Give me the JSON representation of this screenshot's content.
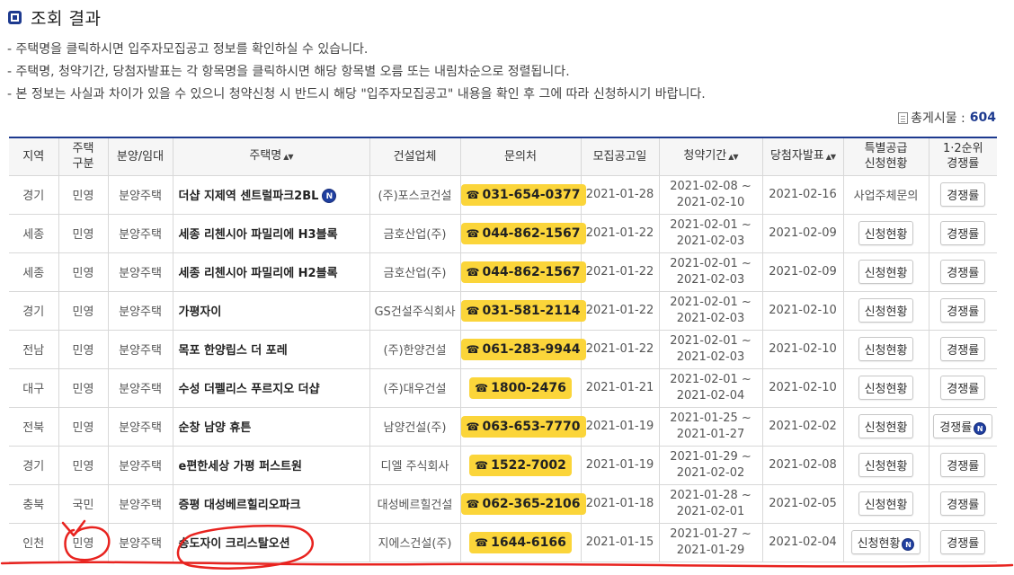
{
  "section_title": "조회 결과",
  "notes": [
    "- 주택명을 클릭하시면 입주자모집공고 정보를 확인하실 수 있습니다.",
    "- 주택명, 청약기간, 당첨자발표는 각 항목명을 클릭하시면 해당 항목별 오름 또는 내림차순으로 정렬됩니다.",
    "- 본 정보는 사실과 차이가 있을 수 있으니 청약신청 시 반드시 해당 \"입주자모집공고\" 내용을 확인 후 그에 따라 신청하시기 바랍니다."
  ],
  "total": {
    "label": "총게시물 :",
    "count": "604"
  },
  "headers": {
    "region": "지역",
    "house_type_1": "주택",
    "house_type_2": "구분",
    "sale_rent": "분양/임대",
    "name": "주택명",
    "builder": "건설업체",
    "contact": "문의처",
    "announce": "모집공고일",
    "period": "청약기간",
    "winner": "당첨자발표",
    "special_1": "특별공급",
    "special_2": "신청현황",
    "rank_1": "1·2순위",
    "rank_2": "경쟁률"
  },
  "sort_icon": "▲▼",
  "new_badge": "N",
  "phone_icon": "☎",
  "rows": [
    {
      "region": "경기",
      "type": "민영",
      "sale": "분양주택",
      "name": "더샵 지제역 센트럴파크2BL",
      "name_new": true,
      "builder": "(주)포스코건설",
      "phone": "031-654-0377",
      "announce": "2021-01-28",
      "period_start": "2021-02-08 ~",
      "period_end": "2021-02-10",
      "winner": "2021-02-16",
      "special": "사업주체문의",
      "special_is_button": false,
      "special_new": false,
      "rank": "경쟁률",
      "rank_new": false
    },
    {
      "region": "세종",
      "type": "민영",
      "sale": "분양주택",
      "name": "세종 리첸시아 파밀리에 H3블록",
      "name_new": false,
      "builder": "금호산업(주)",
      "phone": "044-862-1567",
      "announce": "2021-01-22",
      "period_start": "2021-02-01 ~",
      "period_end": "2021-02-03",
      "winner": "2021-02-09",
      "special": "신청현황",
      "special_is_button": true,
      "special_new": false,
      "rank": "경쟁률",
      "rank_new": false
    },
    {
      "region": "세종",
      "type": "민영",
      "sale": "분양주택",
      "name": "세종 리첸시아 파밀리에 H2블록",
      "name_new": false,
      "builder": "금호산업(주)",
      "phone": "044-862-1567",
      "announce": "2021-01-22",
      "period_start": "2021-02-01 ~",
      "period_end": "2021-02-03",
      "winner": "2021-02-09",
      "special": "신청현황",
      "special_is_button": true,
      "special_new": false,
      "rank": "경쟁률",
      "rank_new": false
    },
    {
      "region": "경기",
      "type": "민영",
      "sale": "분양주택",
      "name": "가평자이",
      "name_new": false,
      "builder": "GS건설주식회사",
      "phone": "031-581-2114",
      "announce": "2021-01-22",
      "period_start": "2021-02-01 ~",
      "period_end": "2021-02-03",
      "winner": "2021-02-10",
      "special": "신청현황",
      "special_is_button": true,
      "special_new": false,
      "rank": "경쟁률",
      "rank_new": false
    },
    {
      "region": "전남",
      "type": "민영",
      "sale": "분양주택",
      "name": "목포 한양립스 더 포레",
      "name_new": false,
      "builder": "(주)한양건설",
      "phone": "061-283-9944",
      "announce": "2021-01-22",
      "period_start": "2021-02-01 ~",
      "period_end": "2021-02-03",
      "winner": "2021-02-10",
      "special": "신청현황",
      "special_is_button": true,
      "special_new": false,
      "rank": "경쟁률",
      "rank_new": false
    },
    {
      "region": "대구",
      "type": "민영",
      "sale": "분양주택",
      "name": "수성 더펠리스 푸르지오 더샵",
      "name_new": false,
      "builder": "(주)대우건설",
      "phone": "1800-2476",
      "announce": "2021-01-21",
      "period_start": "2021-02-01 ~",
      "period_end": "2021-02-04",
      "winner": "2021-02-10",
      "special": "신청현황",
      "special_is_button": true,
      "special_new": false,
      "rank": "경쟁률",
      "rank_new": false
    },
    {
      "region": "전북",
      "type": "민영",
      "sale": "분양주택",
      "name": "순창 남양 휴튼",
      "name_new": false,
      "builder": "남양건설(주)",
      "phone": "063-653-7770",
      "announce": "2021-01-19",
      "period_start": "2021-01-25 ~",
      "period_end": "2021-01-27",
      "winner": "2021-02-02",
      "special": "신청현황",
      "special_is_button": true,
      "special_new": false,
      "rank": "경쟁률",
      "rank_new": true
    },
    {
      "region": "경기",
      "type": "민영",
      "sale": "분양주택",
      "name": "e편한세상 가평 퍼스트원",
      "name_new": false,
      "builder": "디엘 주식회사",
      "phone": "1522-7002",
      "announce": "2021-01-19",
      "period_start": "2021-01-29 ~",
      "period_end": "2021-02-02",
      "winner": "2021-02-08",
      "special": "신청현황",
      "special_is_button": true,
      "special_new": false,
      "rank": "경쟁률",
      "rank_new": false
    },
    {
      "region": "충북",
      "type": "국민",
      "sale": "분양주택",
      "name": "증평 대성베르힐리오파크",
      "name_new": false,
      "builder": "대성베르힐건설",
      "phone": "062-365-2106",
      "announce": "2021-01-18",
      "period_start": "2021-01-28 ~",
      "period_end": "2021-02-01",
      "winner": "2021-02-05",
      "special": "신청현황",
      "special_is_button": true,
      "special_new": false,
      "rank": "경쟁률",
      "rank_new": false
    },
    {
      "region": "인천",
      "type": "민영",
      "sale": "분양주택",
      "name": "송도자이 크리스탈오션",
      "name_new": false,
      "builder": "지에스건설(주)",
      "phone": "1644-6166",
      "announce": "2021-01-15",
      "period_start": "2021-01-27 ~",
      "period_end": "2021-01-29",
      "winner": "2021-02-04",
      "special": "신청현황",
      "special_is_button": true,
      "special_new": true,
      "rank": "경쟁률",
      "rank_new": false
    }
  ],
  "colors": {
    "accent": "#1d3a8f",
    "phone_bg": "#fbd53a",
    "annotation": "#e8231f"
  }
}
